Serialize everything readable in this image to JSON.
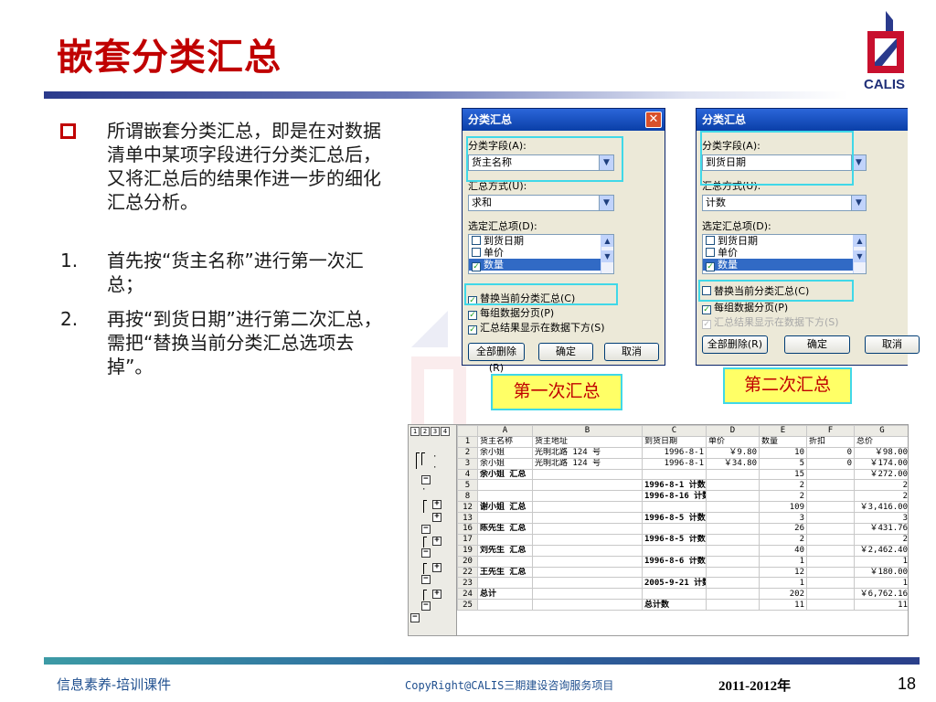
{
  "slide": {
    "title": "嵌套分类汇总",
    "logo_text": "CALIS",
    "intro": "所谓嵌套分类汇总，即是在对数据清单中某项字段进行分类汇总后，又将汇总后的结果作进一步的细化汇总分析。",
    "steps": [
      {
        "num": "1.",
        "text": "首先按“货主名称”进行第一次汇总；"
      },
      {
        "num": "2.",
        "text": "再按“到货日期”进行第二次汇总，需把“替换当前分类汇总选项去掉”。"
      }
    ]
  },
  "dialog1": {
    "title": "分类汇总",
    "group_by_label": "分类字段(A):",
    "group_by_value": "货主名称",
    "method_label": "汇总方式(U):",
    "method_value": "求和",
    "items_label": "选定汇总项(D):",
    "items": [
      {
        "label": "到货日期",
        "checked": false
      },
      {
        "label": "单价",
        "checked": false
      },
      {
        "label": "数量",
        "checked": true
      }
    ],
    "replace_label": "替换当前分类汇总(C)",
    "pagebreak_label": "每组数据分页(P)",
    "below_label": "汇总结果显示在数据下方(S)",
    "remove_all": "全部删除(R)",
    "ok": "确定",
    "cancel": "取消",
    "caption": "第一次汇总"
  },
  "dialog2": {
    "title": "分类汇总",
    "group_by_label": "分类字段(A):",
    "group_by_value": "到货日期",
    "method_label": "汇总方式(U):",
    "method_value": "计数",
    "items_label": "选定汇总项(D):",
    "items": [
      {
        "label": "到货日期",
        "checked": false
      },
      {
        "label": "单价",
        "checked": false
      },
      {
        "label": "数量",
        "checked": true
      }
    ],
    "replace_label": "替换当前分类汇总(C)",
    "pagebreak_label": "每组数据分页(P)",
    "below_label": "汇总结果显示在数据下方(S)",
    "remove_all": "全部删除(R)",
    "ok": "确定",
    "cancel": "取消",
    "caption": "第二次汇总"
  },
  "sheet": {
    "levels": [
      "1",
      "2",
      "3",
      "4"
    ],
    "columns": [
      "A",
      "B",
      "C",
      "D",
      "E",
      "F",
      "G"
    ],
    "rows": [
      {
        "n": "1",
        "cells": [
          "货主名称",
          "货主地址",
          "到货日期",
          "单价",
          "数量",
          "折扣",
          "总价"
        ]
      },
      {
        "n": "2",
        "cells": [
          "余小姐",
          "光明北路 124 号",
          "1996-8-1",
          "￥9.80",
          "10",
          "0",
          "￥98.00"
        ]
      },
      {
        "n": "3",
        "cells": [
          "余小姐",
          "光明北路 124 号",
          "1996-8-1",
          "￥34.80",
          "5",
          "0",
          "￥174.00"
        ]
      },
      {
        "n": "4",
        "cells": [
          "余小姐 汇总",
          "",
          "",
          "",
          "15",
          "",
          "￥272.00"
        ]
      },
      {
        "n": "5",
        "cells": [
          "",
          "",
          "1996-8-1 计数",
          "",
          "2",
          "",
          "2"
        ]
      },
      {
        "n": "8",
        "cells": [
          "",
          "",
          "1996-8-16 计数",
          "",
          "2",
          "",
          "2"
        ]
      },
      {
        "n": "12",
        "cells": [
          "谢小姐 汇总",
          "",
          "",
          "",
          "109",
          "",
          "￥3,416.00"
        ]
      },
      {
        "n": "13",
        "cells": [
          "",
          "",
          "1996-8-5 计数",
          "",
          "3",
          "",
          "3"
        ]
      },
      {
        "n": "16",
        "cells": [
          "陈先生 汇总",
          "",
          "",
          "",
          "26",
          "",
          "￥431.76"
        ]
      },
      {
        "n": "17",
        "cells": [
          "",
          "",
          "1996-8-5 计数",
          "",
          "2",
          "",
          "2"
        ]
      },
      {
        "n": "19",
        "cells": [
          "刘先生 汇总",
          "",
          "",
          "",
          "40",
          "",
          "￥2,462.40"
        ]
      },
      {
        "n": "20",
        "cells": [
          "",
          "",
          "1996-8-6 计数",
          "",
          "1",
          "",
          "1"
        ]
      },
      {
        "n": "22",
        "cells": [
          "王先生 汇总",
          "",
          "",
          "",
          "12",
          "",
          "￥180.00"
        ]
      },
      {
        "n": "23",
        "cells": [
          "",
          "",
          "2005-9-21 计数",
          "",
          "1",
          "",
          "1"
        ]
      },
      {
        "n": "24",
        "cells": [
          "总计",
          "",
          "",
          "",
          "202",
          "",
          "￥6,762.16"
        ]
      },
      {
        "n": "25",
        "cells": [
          "",
          "",
          "总计数",
          "",
          "11",
          "",
          "11"
        ]
      }
    ]
  },
  "footer": {
    "left": "信息素养-培训课件",
    "middle": "CopyRight@CALIS三期建设咨询服务项目",
    "year": "2011-2012年",
    "page": "18"
  },
  "colors": {
    "title": "#c00000",
    "highlight": "#40d8e8",
    "label_bg": "#ffff66",
    "selected_column": "#f7c96a"
  }
}
